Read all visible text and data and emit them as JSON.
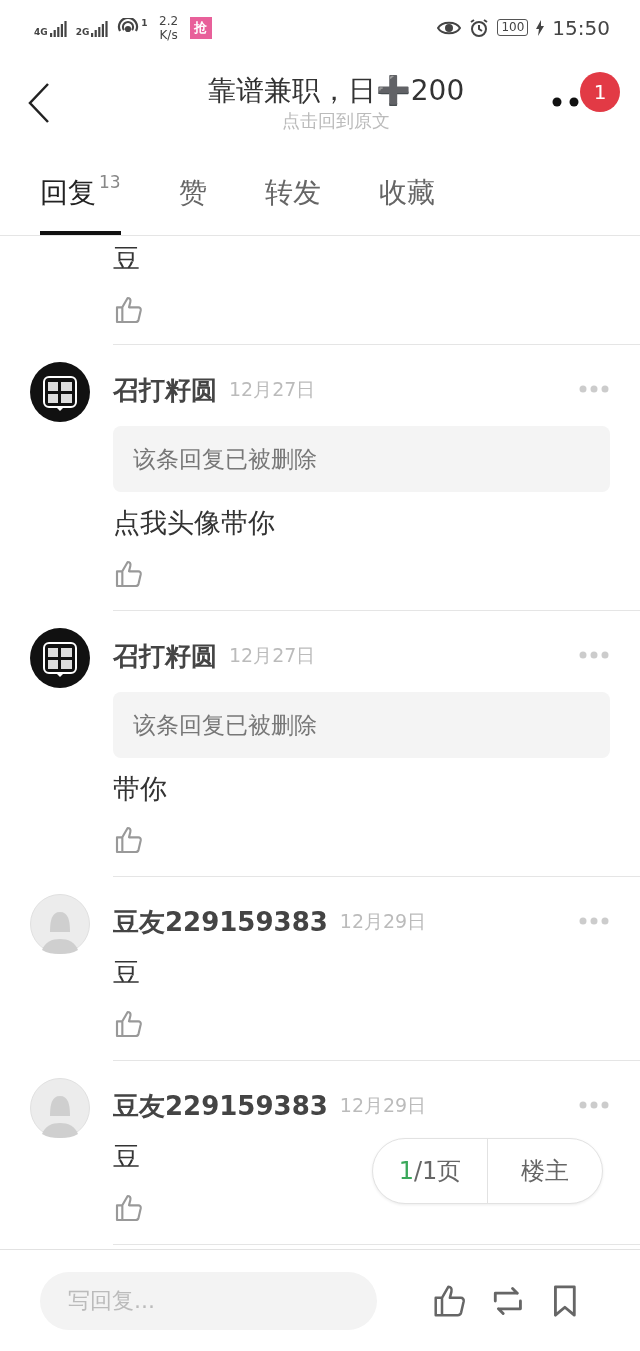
{
  "status_bar": {
    "network_1": "4G",
    "network_2": "2G",
    "wifi_count": "1",
    "speed": "2.2 K/s",
    "app_badge": "抢",
    "battery": "100",
    "time": "15:50"
  },
  "header": {
    "title": "靠谱兼职，日➕200",
    "subtitle": "点击回到原文",
    "badge": "1"
  },
  "tabs": [
    {
      "label": "回复",
      "count": "13",
      "selected": true
    },
    {
      "label": "赞",
      "selected": false
    },
    {
      "label": "转发",
      "selected": false
    },
    {
      "label": "收藏",
      "selected": false
    }
  ],
  "comments": [
    {
      "kind": "partial",
      "body": "豆"
    },
    {
      "kind": "full",
      "name": "召打籽圆",
      "date": "12月27日",
      "deleted_quote": "该条回复已被删除",
      "body": "点我头像带你"
    },
    {
      "kind": "full",
      "name": "召打籽圆",
      "date": "12月27日",
      "deleted_quote": "该条回复已被删除",
      "body": "带你"
    },
    {
      "kind": "full",
      "avatar": {
        "kind": "silhouette"
      },
      "name": "豆友229159383",
      "date": "12月29日",
      "body": "豆"
    },
    {
      "kind": "full",
      "avatar": {
        "kind": "silhouette"
      },
      "name": "豆友229159383",
      "date": "12月29日",
      "body": "豆"
    }
  ],
  "pager": {
    "current": "1",
    "rest": "/1页",
    "owner": "楼主"
  },
  "reply_bar": {
    "placeholder": "写回复..."
  }
}
